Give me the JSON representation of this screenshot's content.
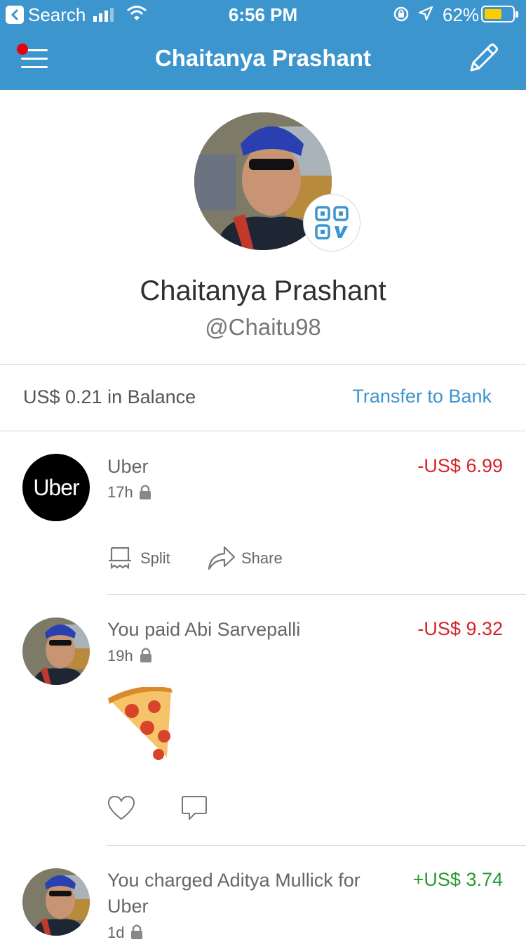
{
  "status_bar": {
    "back_label": "Search",
    "time": "6:56 PM",
    "battery_pct": "62%",
    "battery_level": 0.62
  },
  "nav": {
    "title": "Chaitanya Prashant",
    "has_notification": true
  },
  "profile": {
    "name": "Chaitanya Prashant",
    "handle": "@Chaitu98"
  },
  "balance": {
    "text": "US$ 0.21 in Balance",
    "transfer_label": "Transfer to Bank"
  },
  "feed": [
    {
      "avatar": "uber-logo",
      "avatar_text": "Uber",
      "title": "Uber",
      "time": "17h",
      "amount": "-US$ 6.99",
      "amount_color": "#d6222a",
      "actions": {
        "split": "Split",
        "share": "Share"
      }
    },
    {
      "avatar": "user-photo",
      "title": "You paid Abi Sarvepalli",
      "time": "19h",
      "amount": "-US$ 9.32",
      "amount_color": "#d6222a",
      "note_emoji": "pizza"
    },
    {
      "avatar": "user-photo",
      "title_line1": "You charged Aditya Mullick for",
      "title_line2": "Uber",
      "time": "1d",
      "amount": "+US$ 3.74",
      "amount_color": "#2b9a31"
    }
  ],
  "colors": {
    "brand": "#3d95ce",
    "negative": "#d6222a",
    "positive": "#2b9a31"
  }
}
